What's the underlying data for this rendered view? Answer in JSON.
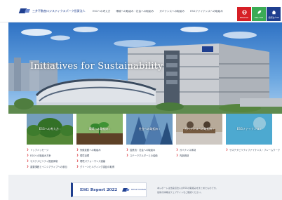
{
  "header": {
    "logo_text": "三井不動産ロジスティクスパーク投資法人",
    "nav": [
      "ESGへの考え方",
      "環境への取組み・社会への取組み",
      "ガバナンスへの取組み",
      "ESGファイナンスへの取組み"
    ],
    "buttons": {
      "english": "ENGLISH",
      "esg_top": "ESG TOP",
      "home": "投資法人HP"
    }
  },
  "hero": {
    "title": "Initiatives for Sustainability"
  },
  "cards": [
    {
      "title": "ESGへの考え方",
      "links": [
        "トップメッセージ",
        "ESGへの取組み方針",
        "サステナビリティ推進体制",
        "重要課題とイニシアティブへの参加"
      ]
    },
    {
      "title": "環境への取組み",
      "links": [
        "気候変動への取組み",
        "環境目標",
        "環境パフォーマンス実績",
        "グリーンビルディング認証の取得"
      ]
    },
    {
      "title": "社会への取組み",
      "links": [
        "従業員・社会への取組み",
        "ステークホルダーとの協働"
      ]
    },
    {
      "title": "ガバナンスへの取組み",
      "links": [
        "ガバナンス体制",
        "内部統制"
      ]
    },
    {
      "title": "ESGファイナンス",
      "links": [
        "サステナビリティファイナンス・フレームワーク"
      ]
    }
  ],
  "footer": {
    "report_title": "ESG Report 2022",
    "report_logo_text": "MITSUI FUDOSAN",
    "note_line1": "本レポートは当投資法人のESGの取組みをまとめたものです。",
    "note_line2": "最新の情報はウェブサイトをご確認ください。"
  },
  "colors": {
    "brand_navy": "#1f3f8f",
    "english_red": "#d61f26",
    "esg_green": "#3bab55",
    "link_arrow": "#d61f26"
  }
}
